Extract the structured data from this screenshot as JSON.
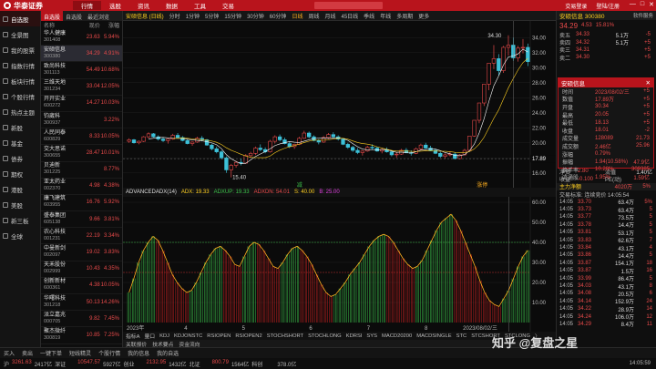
{
  "topbar": {
    "brand": "华泰证券",
    "menus": [
      "行情",
      "选股",
      "资讯",
      "数据",
      "工具",
      "交易"
    ],
    "active_menu": 0,
    "trade_login": "交易登录",
    "user": "登陆/注册",
    "winbtns": [
      "—",
      "□",
      "✕"
    ]
  },
  "sidebar": [
    {
      "label": "自选股",
      "icon": "star-icon"
    },
    {
      "label": "全景图",
      "icon": "grid-icon"
    },
    {
      "label": "我的股票",
      "icon": "briefcase-icon"
    },
    {
      "label": "指数行情",
      "icon": "chart-icon"
    },
    {
      "label": "板块行情",
      "icon": "layers-icon"
    },
    {
      "label": "个股行情",
      "icon": "list-icon"
    },
    {
      "label": "热点主题",
      "icon": "fire-icon"
    },
    {
      "label": "新股",
      "icon": "new-icon"
    },
    {
      "label": "基金",
      "icon": "fund-icon"
    },
    {
      "label": "债券",
      "icon": "bond-icon"
    },
    {
      "label": "期权",
      "icon": "option-icon"
    },
    {
      "label": "港股",
      "icon": "hk-icon"
    },
    {
      "label": "美股",
      "icon": "us-icon"
    },
    {
      "label": "新三板",
      "icon": "sanban-icon"
    },
    {
      "label": "全球",
      "icon": "globe-icon"
    }
  ],
  "stocklist": {
    "tabs": [
      "自选股",
      "自选股",
      "最近浏览"
    ],
    "active_tab": 0,
    "headers": [
      "名称",
      "现价",
      "涨幅"
    ],
    "rows": [
      {
        "name": "华人健康",
        "code": "301408",
        "price": "23.63",
        "pct": "5.94%"
      },
      {
        "name": "安硕信息",
        "code": "300380",
        "price": "34.29",
        "pct": "4.91%"
      },
      {
        "name": "致尚科技",
        "code": "301113",
        "price": "54.49",
        "pct": "10.68%"
      },
      {
        "name": "三维天地",
        "code": "301234",
        "price": "33.04",
        "pct": "12.05%"
      },
      {
        "name": "开开实业",
        "code": "600272",
        "price": "14.27",
        "pct": "10.03%"
      },
      {
        "name": "钧崴科",
        "code": "300937",
        "price": "",
        "pct": "3.22%"
      },
      {
        "name": "人民同泰",
        "code": "600829",
        "price": "8.33",
        "pct": "10.05%"
      },
      {
        "name": "交大思诺",
        "code": "300655",
        "price": "28.47",
        "pct": "10.01%"
      },
      {
        "name": "贝迪新",
        "code": "301225",
        "price": "",
        "pct": "8.77%"
      },
      {
        "name": "亚太药业",
        "code": "002370",
        "price": "4.98",
        "pct": "4.38%"
      },
      {
        "name": "康飞建筑",
        "code": "603955",
        "price": "16.76",
        "pct": "5.92%"
      },
      {
        "name": "盛泰集团",
        "code": "605138",
        "price": "9.66",
        "pct": "3.81%"
      },
      {
        "name": "农心科技",
        "code": "001231",
        "price": "22.19",
        "pct": "3.34%"
      },
      {
        "name": "中曼新剑",
        "code": "002097",
        "price": "19.02",
        "pct": "3.83%"
      },
      {
        "name": "天禾股份",
        "code": "002999",
        "price": "10.43",
        "pct": "4.35%"
      },
      {
        "name": "创新新材",
        "code": "600361",
        "price": "4.38",
        "pct": "10.05%"
      },
      {
        "name": "华曙科技",
        "code": "301218",
        "price": "50.13",
        "pct": "14.26%"
      },
      {
        "name": "派立嘉兆",
        "code": "000705",
        "price": "9.82",
        "pct": "7.45%"
      },
      {
        "name": "聚杰微纤",
        "code": "300819",
        "price": "10.85",
        "pct": "7.25%"
      }
    ]
  },
  "chart": {
    "title": "安硕信息 (日线)",
    "periods": [
      "分时",
      "1分钟",
      "5分钟",
      "15分钟",
      "30分钟",
      "60分钟",
      "日线",
      "周线",
      "月线",
      "45日线",
      "季线",
      "年线",
      "多周期",
      "更多"
    ],
    "active_period": 6,
    "y_ticks": [
      "34.00",
      "32.00",
      "30.00",
      "28.00",
      "26.00",
      "24.00",
      "22.00",
      "20.00",
      "18.00",
      "16.00"
    ],
    "high_label": "34.30",
    "low_label": "15.40",
    "last_label": "17.89",
    "indicator": {
      "name": "ADVANCEDADX(14)",
      "adx": "ADX: 19.33",
      "adxr": "ADXUP: 19.33",
      "mdi": "ADXDN: 54.01",
      "s": "S: 40.00",
      "b": "B: 25.00"
    },
    "adx_ticks": [
      "60.00",
      "50.00",
      "40.00",
      "30.00",
      "20.00",
      "10.00"
    ],
    "x_labels": [
      "2023年",
      "4",
      "5",
      "6",
      "7",
      "8",
      "2023/08/02/三"
    ],
    "buy_label": "减",
    "sell_label": "涨停",
    "indicator_tabs": [
      "指标A",
      "量口",
      "KDJ",
      "KDJONSTC",
      "RSIOPEN",
      "RSIOPEN2",
      "STOCHSHORT",
      "STOCHLONG",
      "KDRSI",
      "SYS",
      "MACD20200",
      "MACDSINGLE",
      "STC",
      "STCSHORT",
      "STCLONG",
      "〉"
    ],
    "sub_tabs": [
      "关联报价",
      "技术要点",
      "资金流向"
    ],
    "candles": [
      [
        20.2,
        20.6,
        20.0,
        20.4
      ],
      [
        20.4,
        20.5,
        19.9,
        20.0
      ],
      [
        20.0,
        20.3,
        19.8,
        20.2
      ],
      [
        20.2,
        20.9,
        20.1,
        20.8
      ],
      [
        20.8,
        21.4,
        20.6,
        21.2
      ],
      [
        21.2,
        21.3,
        20.7,
        20.8
      ],
      [
        20.8,
        21.0,
        20.3,
        20.5
      ],
      [
        20.5,
        20.7,
        20.1,
        20.3
      ],
      [
        20.3,
        20.6,
        19.9,
        20.5
      ],
      [
        20.5,
        21.2,
        20.4,
        21.0
      ],
      [
        21.0,
        21.3,
        20.6,
        20.7
      ],
      [
        20.7,
        20.9,
        20.2,
        20.3
      ],
      [
        20.3,
        20.5,
        19.8,
        19.9
      ],
      [
        19.9,
        20.2,
        19.6,
        20.1
      ],
      [
        20.1,
        20.8,
        20.0,
        20.6
      ],
      [
        20.6,
        20.9,
        20.2,
        20.4
      ],
      [
        20.4,
        20.5,
        19.6,
        19.7
      ],
      [
        19.7,
        19.9,
        19.0,
        19.2
      ],
      [
        19.2,
        19.5,
        18.6,
        18.8
      ],
      [
        18.8,
        19.0,
        17.8,
        18.0
      ],
      [
        18.0,
        18.2,
        16.0,
        16.4
      ],
      [
        16.4,
        17.2,
        15.4,
        17.0
      ],
      [
        17.0,
        17.6,
        16.7,
        17.4
      ],
      [
        17.4,
        17.9,
        17.0,
        17.3
      ],
      [
        17.3,
        18.5,
        17.2,
        18.3
      ],
      [
        18.3,
        18.8,
        18.0,
        18.6
      ],
      [
        18.6,
        19.5,
        18.4,
        19.3
      ],
      [
        19.3,
        19.8,
        18.9,
        19.1
      ],
      [
        19.1,
        19.4,
        18.6,
        18.8
      ],
      [
        18.8,
        20.4,
        18.7,
        20.2
      ],
      [
        20.2,
        21.0,
        19.9,
        20.8
      ],
      [
        20.8,
        21.1,
        20.2,
        20.4
      ],
      [
        20.4,
        20.7,
        19.8,
        19.9
      ],
      [
        19.9,
        20.2,
        19.3,
        19.5
      ],
      [
        19.5,
        19.9,
        19.2,
        19.8
      ],
      [
        19.8,
        20.8,
        19.7,
        20.6
      ],
      [
        20.6,
        21.6,
        20.5,
        21.3
      ],
      [
        21.3,
        21.5,
        20.6,
        20.8
      ],
      [
        20.8,
        21.0,
        20.2,
        20.3
      ],
      [
        20.3,
        20.5,
        19.8,
        20.1
      ],
      [
        20.1,
        20.9,
        20.0,
        20.7
      ],
      [
        20.7,
        21.3,
        20.5,
        21.1
      ],
      [
        21.1,
        21.4,
        20.6,
        20.8
      ],
      [
        20.8,
        21.0,
        20.3,
        20.5
      ],
      [
        20.5,
        20.6,
        19.7,
        19.8
      ],
      [
        19.8,
        20.0,
        19.2,
        19.4
      ],
      [
        19.4,
        19.6,
        18.8,
        19.0
      ],
      [
        19.0,
        19.3,
        18.5,
        18.7
      ],
      [
        18.7,
        19.0,
        18.3,
        18.9
      ],
      [
        18.9,
        19.6,
        18.8,
        19.4
      ],
      [
        19.4,
        19.8,
        19.1,
        19.3
      ],
      [
        19.3,
        19.5,
        18.8,
        18.9
      ],
      [
        18.9,
        19.3,
        18.6,
        19.1
      ],
      [
        19.1,
        19.4,
        18.7,
        18.8
      ],
      [
        18.8,
        19.0,
        18.2,
        18.4
      ],
      [
        18.4,
        18.7,
        18.0,
        18.5
      ],
      [
        18.5,
        19.2,
        18.4,
        19.0
      ],
      [
        19.0,
        19.3,
        18.6,
        18.7
      ],
      [
        18.7,
        19.0,
        18.3,
        18.6
      ],
      [
        18.6,
        19.4,
        18.5,
        19.2
      ],
      [
        19.2,
        19.9,
        19.0,
        19.7
      ],
      [
        19.7,
        20.0,
        19.2,
        19.3
      ],
      [
        19.3,
        19.6,
        18.9,
        19.0
      ],
      [
        19.0,
        19.2,
        18.5,
        18.6
      ],
      [
        18.6,
        18.8,
        18.0,
        18.2
      ],
      [
        18.2,
        18.6,
        17.9,
        18.4
      ],
      [
        18.4,
        18.9,
        18.2,
        18.5
      ],
      [
        18.5,
        18.7,
        17.8,
        17.9
      ],
      [
        17.9,
        18.5,
        17.8,
        18.4
      ],
      [
        18.4,
        19.2,
        18.3,
        19.0
      ],
      [
        19.0,
        20.9,
        18.9,
        20.9
      ],
      [
        20.9,
        23.0,
        20.8,
        23.0
      ],
      [
        23.0,
        25.3,
        22.6,
        25.3
      ],
      [
        25.3,
        27.8,
        24.9,
        27.8
      ],
      [
        27.8,
        30.6,
        27.0,
        30.6
      ],
      [
        30.6,
        33.0,
        29.8,
        31.2
      ],
      [
        31.2,
        31.8,
        29.0,
        29.6
      ],
      [
        29.6,
        32.9,
        29.3,
        32.7
      ],
      [
        32.7,
        34.3,
        31.6,
        33.0
      ],
      [
        33.0,
        34.0,
        30.9,
        31.3
      ],
      [
        31.3,
        32.9,
        30.8,
        32.6
      ],
      [
        32.6,
        33.8,
        31.9,
        32.7
      ],
      [
        32.7,
        33.2,
        30.2,
        30.8
      ]
    ],
    "adx": [
      15,
      22,
      30,
      36,
      40,
      43,
      41,
      36,
      30,
      24,
      20,
      17,
      15,
      16,
      20,
      25,
      30,
      34,
      37,
      38,
      36,
      33,
      29,
      28,
      33,
      38,
      40,
      39,
      36,
      32,
      28,
      27,
      30,
      34,
      37,
      38,
      36,
      33,
      29,
      24,
      19,
      15,
      13,
      14,
      17,
      20,
      24,
      27,
      30,
      34,
      38,
      41,
      43,
      44,
      43,
      40,
      36,
      32,
      29,
      27,
      28,
      31,
      36,
      41,
      46,
      50,
      52,
      54,
      51,
      46,
      40,
      34,
      28,
      21,
      15,
      11,
      9,
      8,
      12,
      16,
      22,
      28,
      33,
      36
    ]
  },
  "rightpanel": {
    "title": "安硕信息 300380",
    "software": "软件服务",
    "price": "34.29",
    "chg": "4.53",
    "pct": "15.81%",
    "sells": [
      {
        "k": "卖五",
        "p": "34.33",
        "q": "5.1万",
        "d": "-5"
      },
      {
        "k": "卖四",
        "p": "34.32",
        "q": "5.1万",
        "d": "+5"
      },
      {
        "k": "卖三",
        "p": "34.31",
        "q": "",
        "d": "+5"
      },
      {
        "k": "卖二",
        "p": "34.30",
        "q": "",
        "d": "+5"
      }
    ],
    "stats": [
      {
        "k": "换手",
        "v": "24.83%",
        "k2": "开盘",
        "v2": "1.40亿"
      },
      {
        "k": "净资",
        "v": "2.80",
        "k2": "流值",
        "v2": "1.40亿"
      },
      {
        "k": "收益",
        "v": "-0.100",
        "k2": "PE(动)",
        "v2": ""
      }
    ],
    "flow_title": "主力净额",
    "flow_val": "4020万",
    "flow_pct": "5%",
    "ticks_title": "交易标准: 连续竞价 14:05:54",
    "ticks": [
      {
        "t": "14:05",
        "p": "33.70",
        "q": "63.4万",
        "n": "5%"
      },
      {
        "t": "14:05",
        "p": "33.73",
        "q": "63.4万",
        "n": "5"
      },
      {
        "t": "14:05",
        "p": "33.77",
        "q": "73.5万",
        "n": "5"
      },
      {
        "t": "14:05",
        "p": "33.78",
        "q": "14.4万",
        "n": "5"
      },
      {
        "t": "14:05",
        "p": "33.81",
        "q": "53.1万",
        "n": "5"
      },
      {
        "t": "14:05",
        "p": "33.83",
        "q": "62.6万",
        "n": "7"
      },
      {
        "t": "14:05",
        "p": "33.84",
        "q": "43.1万",
        "n": "4"
      },
      {
        "t": "14:05",
        "p": "33.86",
        "q": "14.4万",
        "n": "5"
      },
      {
        "t": "14:05",
        "p": "33.87",
        "q": "154.1万",
        "n": "18"
      },
      {
        "t": "14:05",
        "p": "33.87",
        "q": "1.5万",
        "n": "16"
      },
      {
        "t": "14:05",
        "p": "33.99",
        "q": "86.4万",
        "n": "5"
      },
      {
        "t": "14:05",
        "p": "34.03",
        "q": "43.1万",
        "n": "8"
      },
      {
        "t": "14:05",
        "p": "34.08",
        "q": "20.5万",
        "n": "6"
      },
      {
        "t": "14:05",
        "p": "34.14",
        "q": "152.9万",
        "n": "24"
      },
      {
        "t": "14:05",
        "p": "34.22",
        "q": "28.9万",
        "n": "14"
      },
      {
        "t": "14:05",
        "p": "34.24",
        "q": "106.0万",
        "n": "12"
      },
      {
        "t": "14:05",
        "p": "34.29",
        "q": "8.4万",
        "n": "11"
      }
    ]
  },
  "popup": {
    "title": "安硕信息",
    "close": "✕",
    "rows": [
      {
        "k": "时间",
        "v": "2023/08/02/三",
        "x": "+5"
      },
      {
        "k": "数值",
        "v": "17.89万",
        "x": "+5"
      },
      {
        "k": "开盘",
        "v": "30.34",
        "x": "+5"
      },
      {
        "k": "最高",
        "v": "20.05",
        "x": "+5"
      },
      {
        "k": "最低",
        "v": "18.13",
        "x": "+5"
      },
      {
        "k": "收盘",
        "v": "18.01",
        "x": "-2"
      },
      {
        "k": "成交量",
        "v": "128089",
        "x": "21.73"
      },
      {
        "k": "成交额",
        "v": "2.46亿",
        "x": "25.96"
      },
      {
        "k": "涨幅",
        "v": "0.79%",
        "x": ""
      },
      {
        "k": "振幅",
        "v": "1.94(10.58%)",
        "x": "47.9亿"
      },
      {
        "k": "换手率",
        "v": "10.28%",
        "x": "309385"
      },
      {
        "k": "流通股",
        "v": "1.95%",
        "x": "1.59亿"
      }
    ]
  },
  "bottombar": [
    "买入",
    "卖出",
    "一键下单",
    "短线精灵",
    "个股行情",
    "我的信息",
    "我的自选"
  ],
  "statusbar": [
    {
      "k": "沪",
      "v": "3261.63",
      "c": "2417亿",
      "s": "深证"
    },
    {
      "k": "",
      "v": "10547.57",
      "c": "5927亿",
      "s": "创业"
    },
    {
      "k": "",
      "v": "2132.95",
      "c": "1432亿",
      "s": "北证"
    },
    {
      "k": "",
      "v": "800.79",
      "c": "1564亿",
      "s": "科创"
    },
    {
      "k": "",
      "v": "",
      "c": "378.0亿",
      "s": ""
    }
  ],
  "status_right": "14:05:59",
  "watermark": "知乎 @复盘之星"
}
